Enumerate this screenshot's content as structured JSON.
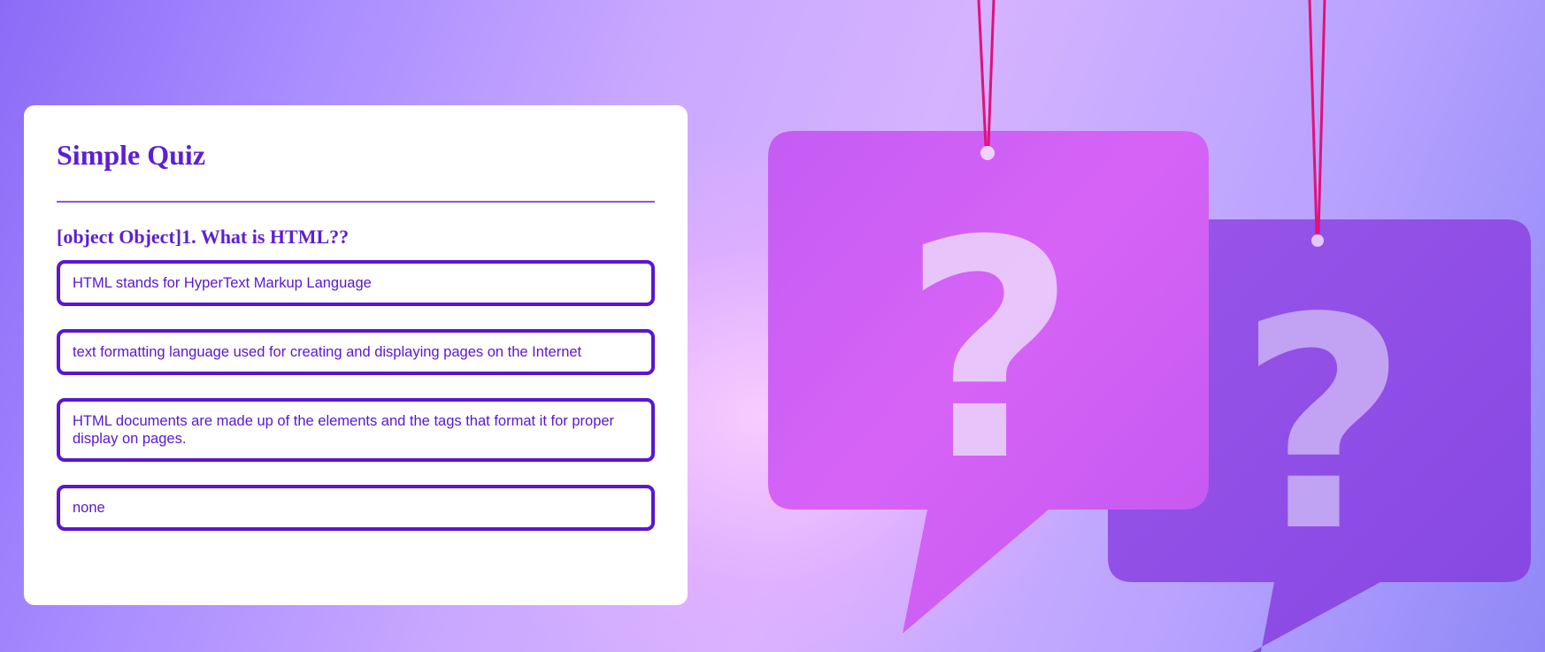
{
  "quiz": {
    "title": "Simple Quiz",
    "question": "[object Object]1. What is HTML??",
    "answers": [
      "HTML stands for HyperText Markup Language",
      "text formatting language used for creating and displaying pages on the Internet",
      "HTML documents are made up of the elements and the tags that format it for proper display on pages.",
      "none"
    ]
  },
  "theme": {
    "accent": "#5d1fd3",
    "card_background": "#ffffff",
    "bubble_primary": "#d25cf5",
    "bubble_secondary": "#8a4ee6"
  },
  "background": {
    "glyphs": [
      "?",
      "?"
    ]
  }
}
